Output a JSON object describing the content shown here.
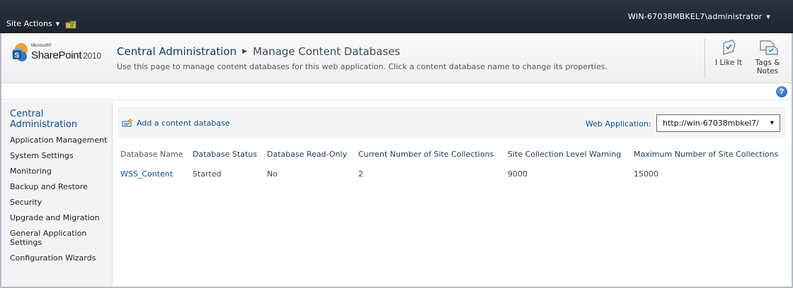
{
  "ribbon": {
    "site_actions": "Site Actions",
    "user": "WIN-67038MBKEL7\\administrator"
  },
  "logo": {
    "microsoft": "Microsoft®",
    "product": "SharePoint",
    "year": "2010"
  },
  "breadcrumb": {
    "root": "Central Administration",
    "current": "Manage Content Databases"
  },
  "page_description": "Use this page to manage content databases for this web application. Click a content database name to change its properties.",
  "social": {
    "like": "I Like It",
    "tags_line1": "Tags &",
    "tags_line2": "Notes"
  },
  "help_glyph": "?",
  "left_nav": {
    "heading_line1": "Central",
    "heading_line2": "Administration",
    "items": [
      "Application Management",
      "System Settings",
      "Monitoring",
      "Backup and Restore",
      "Security",
      "Upgrade and Migration",
      "General Application",
      "Settings",
      "Configuration Wizards"
    ]
  },
  "toolbar": {
    "add_link": "Add a content database",
    "web_app_label": "Web Application:",
    "web_app_value": "http://win-67038mbkel7/"
  },
  "table": {
    "headers": [
      "Database Name",
      "Database Status",
      "Database Read-Only",
      "Current Number of Site Collections",
      "Site Collection Level Warning",
      "Maximum Number of Site Collections"
    ],
    "rows": [
      [
        "WSS_Content",
        "Started",
        "No",
        "2",
        "9000",
        "15000"
      ]
    ]
  },
  "colors": {
    "ribbon_bg": "#1d2430",
    "link": "#0c4d93",
    "nav_bg": "#f3f3f3"
  },
  "icons": [
    "navigate-up-icon",
    "i-like-it-icon",
    "tags-notes-icon",
    "help-icon",
    "add-database-icon",
    "dropdown-caret-icon"
  ]
}
